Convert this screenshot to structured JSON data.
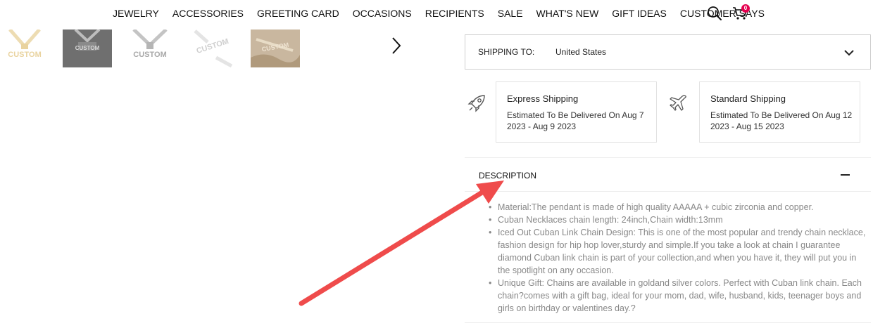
{
  "nav": {
    "items": [
      "JEWELRY",
      "ACCESSORIES",
      "GREETING CARD",
      "OCCASIONS",
      "RECIPIENTS",
      "SALE",
      "WHAT'S NEW",
      "GIFT IDEAS",
      "CUSTOMER SAYS"
    ],
    "icons": [
      "search-icon",
      "cart-icon"
    ],
    "cart_count": "0",
    "badge_color": "#e5004f"
  },
  "thumbnails": {
    "captions": [
      "CUSTOM",
      "CUSTOM",
      "CUSTOM",
      "CUSTOM",
      "CUSTOM"
    ],
    "next_icon": "chevron-right-icon"
  },
  "shipping": {
    "label": "SHIPPING TO:",
    "country": "United States",
    "options": [
      {
        "icon": "rocket-icon",
        "title": "Express Shipping",
        "desc": "Estimated To Be Delivered On Aug 7 2023 - Aug 9 2023"
      },
      {
        "icon": "airplane-icon",
        "title": "Standard Shipping",
        "desc": "Estimated To Be Delivered On Aug 12 2023 - Aug 15 2023"
      }
    ]
  },
  "description": {
    "title": "DESCRIPTION",
    "toggle_icon": "minus-icon",
    "items": [
      "Material:The pendant is made of high quality AAAAA + cubic zirconia and copper.",
      "Cuban Necklaces chain length: 24inch,Chain width:13mm",
      "Iced Out Cuban Link Chain Design: This is one of the most popular and trendy chain necklace, fashion design for hip hop lover,sturdy and simple.If you take a look at chain I guarantee diamond Cuban link chain is part of your collection,and when you have it, they will put you in the spotlight on any occasion.",
      "Unique Gift: Chains are available in goldand silver colors. Perfect with Cuban link chain. Each chain?comes with a gift bag, ideal for your mom, dad, wife, husband, kids, teenager boys and girls on birthday or valentines day.?"
    ]
  },
  "annotation": {
    "color": "#ef4b4b"
  }
}
